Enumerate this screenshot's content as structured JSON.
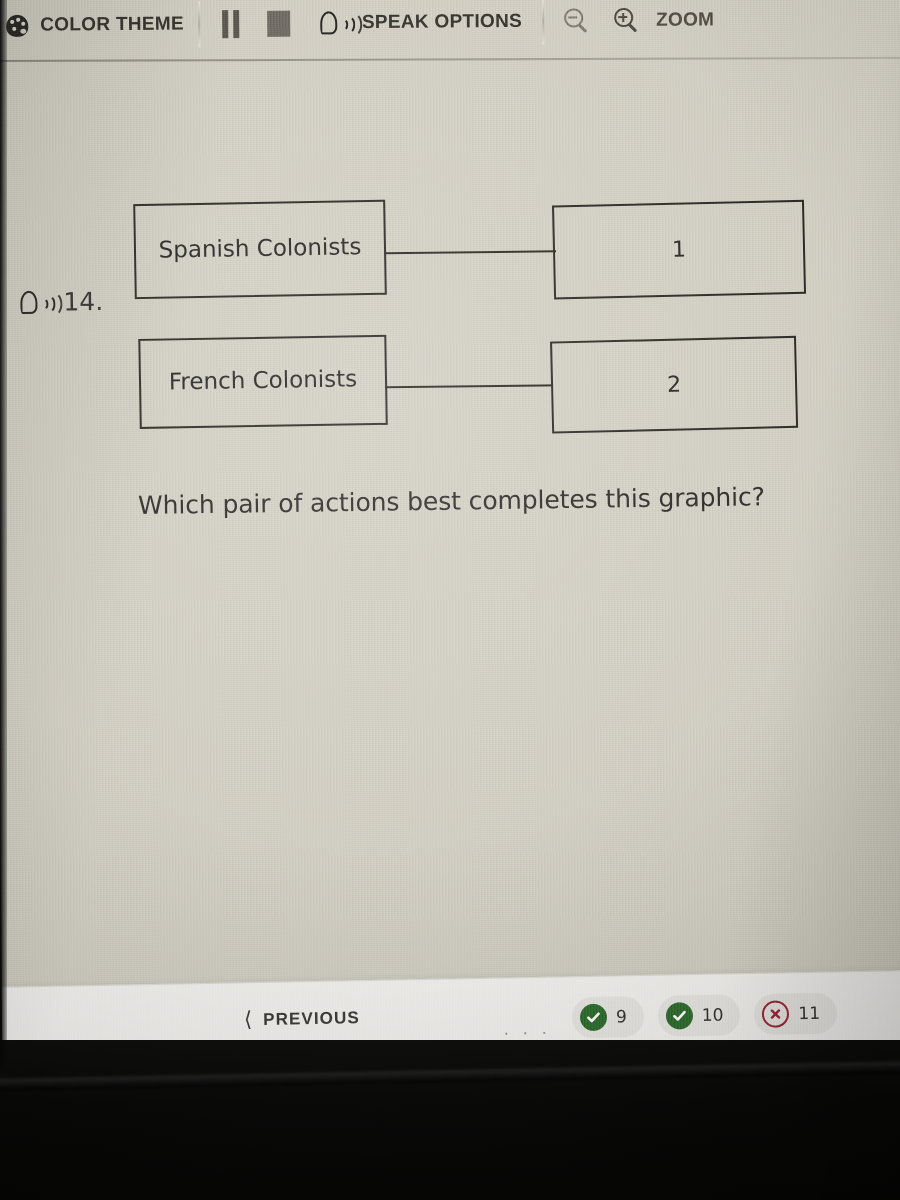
{
  "toolbar": {
    "color_theme_label": "COLOR THEME",
    "color_theme_icon": "palette-icon",
    "pause_icon": "pause-icon",
    "stop_icon": "stop-icon",
    "speak_icon": "speaking-head-icon",
    "speak_options_label": "SPEAK OPTIONS",
    "zoom_out_icon": "magnifier-minus-icon",
    "zoom_in_icon": "magnifier-plus-icon",
    "zoom_label": "ZOOM"
  },
  "question": {
    "number": "14.",
    "speak_icon": "speaking-head-icon",
    "prompt": "Which pair of actions best completes this graphic?"
  },
  "graphic": {
    "rows": [
      {
        "label": "Spanish Colonists",
        "target": "1"
      },
      {
        "label": "French Colonists",
        "target": "2"
      }
    ]
  },
  "bottom_nav": {
    "previous_label": "PREVIOUS",
    "previous_chevron": "chevron-left-icon",
    "ellipsis": "· · ·",
    "chips": [
      {
        "number": "9",
        "status": "correct",
        "icon": "check-circle-icon"
      },
      {
        "number": "10",
        "status": "correct",
        "icon": "check-circle-icon"
      },
      {
        "number": "11",
        "status": "incorrect",
        "icon": "x-circle-icon"
      }
    ]
  },
  "colors": {
    "screen_background": "#cfccc0",
    "text": "#2c2a26",
    "correct_green": "#2f6b2e",
    "incorrect_red": "#9c2335",
    "bottom_bar": "#f2f1ee",
    "chip_background": "#e6e5e1"
  }
}
